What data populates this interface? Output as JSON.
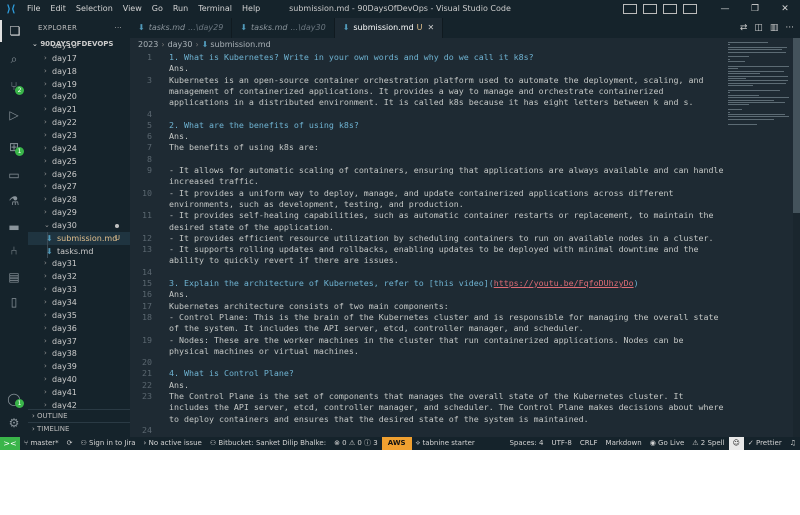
{
  "window": {
    "title": "submission.md - 90DaysOfDevOps - Visual Studio Code",
    "menu": [
      "File",
      "Edit",
      "Selection",
      "View",
      "Go",
      "Run",
      "Terminal",
      "Help"
    ]
  },
  "activity_badges": {
    "source_control": "2",
    "extensions": "1",
    "accounts": "1"
  },
  "explorer": {
    "header": "EXPLORER",
    "root": "90DAYSOFDEVOPS",
    "items": [
      {
        "label": "day16",
        "type": "folder"
      },
      {
        "label": "day17",
        "type": "folder"
      },
      {
        "label": "day18",
        "type": "folder"
      },
      {
        "label": "day19",
        "type": "folder"
      },
      {
        "label": "day20",
        "type": "folder"
      },
      {
        "label": "day21",
        "type": "folder"
      },
      {
        "label": "day22",
        "type": "folder"
      },
      {
        "label": "day23",
        "type": "folder"
      },
      {
        "label": "day24",
        "type": "folder"
      },
      {
        "label": "day25",
        "type": "folder"
      },
      {
        "label": "day26",
        "type": "folder"
      },
      {
        "label": "day27",
        "type": "folder"
      },
      {
        "label": "day28",
        "type": "folder"
      },
      {
        "label": "day29",
        "type": "folder"
      },
      {
        "label": "day30",
        "type": "folder-open"
      },
      {
        "label": "submission.md",
        "type": "file",
        "mark": "U",
        "selected": true
      },
      {
        "label": "tasks.md",
        "type": "file"
      },
      {
        "label": "day31",
        "type": "folder"
      },
      {
        "label": "day32",
        "type": "folder"
      },
      {
        "label": "day33",
        "type": "folder"
      },
      {
        "label": "day34",
        "type": "folder"
      },
      {
        "label": "day35",
        "type": "folder"
      },
      {
        "label": "day36",
        "type": "folder"
      },
      {
        "label": "day37",
        "type": "folder"
      },
      {
        "label": "day38",
        "type": "folder"
      },
      {
        "label": "day39",
        "type": "folder"
      },
      {
        "label": "day40",
        "type": "folder"
      },
      {
        "label": "day41",
        "type": "folder"
      },
      {
        "label": "day42",
        "type": "folder"
      }
    ],
    "outline": "OUTLINE",
    "timeline": "TIMELINE"
  },
  "tabs": [
    {
      "label": "tasks.md",
      "hint": "...\\day29",
      "active": false
    },
    {
      "label": "tasks.md",
      "hint": "...\\day30",
      "active": false
    },
    {
      "label": "submission.md",
      "hint": "U",
      "active": true
    }
  ],
  "breadcrumb": [
    "2023",
    "day30",
    "submission.md"
  ],
  "editor_lines": [
    {
      "n": "1",
      "segs": [
        {
          "t": "1. What is Kubernetes? Write in your own words and why do we call it k8s?",
          "c": "h"
        }
      ]
    },
    {
      "n": "",
      "segs": [
        {
          "t": "Ans."
        }
      ]
    },
    {
      "n": "3",
      "segs": [
        {
          "t": "Kubernetes is an open-source container orchestration platform used to automate the deployment, scaling, and"
        }
      ]
    },
    {
      "n": "",
      "segs": [
        {
          "t": "management of containerized applications. It provides a way to manage and orchestrate containerized"
        }
      ]
    },
    {
      "n": "",
      "segs": [
        {
          "t": "applications in a distributed environment. It is called k8s because it has eight letters between k and s."
        }
      ]
    },
    {
      "n": "4",
      "segs": [
        {
          "t": ""
        }
      ]
    },
    {
      "n": "5",
      "segs": [
        {
          "t": "2. What are the benefits of using k8s?",
          "c": "h"
        }
      ]
    },
    {
      "n": "6",
      "segs": [
        {
          "t": "Ans."
        }
      ]
    },
    {
      "n": "7",
      "segs": [
        {
          "t": "The benefits of using k8s are:"
        }
      ]
    },
    {
      "n": "8",
      "segs": [
        {
          "t": ""
        }
      ]
    },
    {
      "n": "9",
      "segs": [
        {
          "t": "- It allows for automatic scaling of containers, ensuring that applications are always available and can handle"
        }
      ]
    },
    {
      "n": "",
      "segs": [
        {
          "t": "increased traffic."
        }
      ]
    },
    {
      "n": "10",
      "segs": [
        {
          "t": "- It provides a uniform way to deploy, manage, and update containerized applications across different"
        }
      ]
    },
    {
      "n": "",
      "segs": [
        {
          "t": "environments, such as development, testing, and production."
        }
      ]
    },
    {
      "n": "11",
      "segs": [
        {
          "t": "- It provides self-healing capabilities, such as automatic container restarts or replacement, to maintain the"
        }
      ]
    },
    {
      "n": "",
      "segs": [
        {
          "t": "desired state of the application."
        }
      ]
    },
    {
      "n": "12",
      "segs": [
        {
          "t": "- It provides efficient resource utilization by scheduling containers to run on available nodes in a cluster."
        }
      ]
    },
    {
      "n": "13",
      "segs": [
        {
          "t": "- It supports rolling updates and rollbacks, enabling updates to be deployed with minimal downtime and the"
        }
      ]
    },
    {
      "n": "",
      "segs": [
        {
          "t": "ability to quickly revert if there are issues."
        }
      ]
    },
    {
      "n": "14",
      "segs": [
        {
          "t": ""
        }
      ]
    },
    {
      "n": "15",
      "segs": [
        {
          "t": "3. Explain the architecture of Kubernetes, refer to ",
          "c": "h"
        },
        {
          "t": "[this video]",
          "c": "lk"
        },
        {
          "t": "(",
          "c": "h"
        },
        {
          "t": "https://youtu.be/FqfoDUhzyDo",
          "c": "url"
        },
        {
          "t": ")",
          "c": "h"
        }
      ]
    },
    {
      "n": "16",
      "segs": [
        {
          "t": "Ans."
        }
      ]
    },
    {
      "n": "17",
      "segs": [
        {
          "t": "Kubernetes architecture consists of two main components:"
        }
      ]
    },
    {
      "n": "18",
      "segs": [
        {
          "t": "- Control Plane: This is the brain of the Kubernetes cluster and is responsible for managing the overall state"
        }
      ]
    },
    {
      "n": "",
      "segs": [
        {
          "t": "of the system. It includes the API server, etcd, controller manager, and scheduler."
        }
      ]
    },
    {
      "n": "19",
      "segs": [
        {
          "t": "- Nodes: These are the worker machines in the cluster that run containerized applications. Nodes can be"
        }
      ]
    },
    {
      "n": "",
      "segs": [
        {
          "t": "physical machines or virtual machines."
        }
      ]
    },
    {
      "n": "20",
      "segs": [
        {
          "t": ""
        }
      ]
    },
    {
      "n": "21",
      "segs": [
        {
          "t": "4. What is Control Plane?",
          "c": "h"
        }
      ]
    },
    {
      "n": "22",
      "segs": [
        {
          "t": "Ans."
        }
      ]
    },
    {
      "n": "23",
      "segs": [
        {
          "t": "The Control Plane is the set of components that manages the overall state of the Kubernetes cluster. It"
        }
      ]
    },
    {
      "n": "",
      "segs": [
        {
          "t": "includes the API server, etcd, controller manager, and scheduler. The Control Plane makes decisions about where"
        }
      ]
    },
    {
      "n": "",
      "segs": [
        {
          "t": "to deploy containers and ensures that the desired state of the system is maintained."
        }
      ]
    },
    {
      "n": "24",
      "segs": [
        {
          "t": ""
        }
      ]
    },
    {
      "n": "25",
      "segs": [
        {
          "t": "5. Write the difference between kubectl and kubelets.",
          "c": "h"
        }
      ]
    }
  ],
  "status": {
    "remote": "><",
    "branch": "master*",
    "sync": "⟳",
    "jira": "Sign in to Jira",
    "issue": "No active issue",
    "bitbucket": "Bitbucket: Sanket Dilip Bhalke:",
    "problems": "⊗ 0 ⚠ 0 ⓘ 3",
    "aws": "AWS",
    "tabnine": "tabnine starter",
    "spaces": "Spaces: 4",
    "encoding": "UTF-8",
    "eol": "CRLF",
    "language": "Markdown",
    "golive": "Go Live",
    "spell": "2 Spell",
    "prettier": "Prettier"
  }
}
